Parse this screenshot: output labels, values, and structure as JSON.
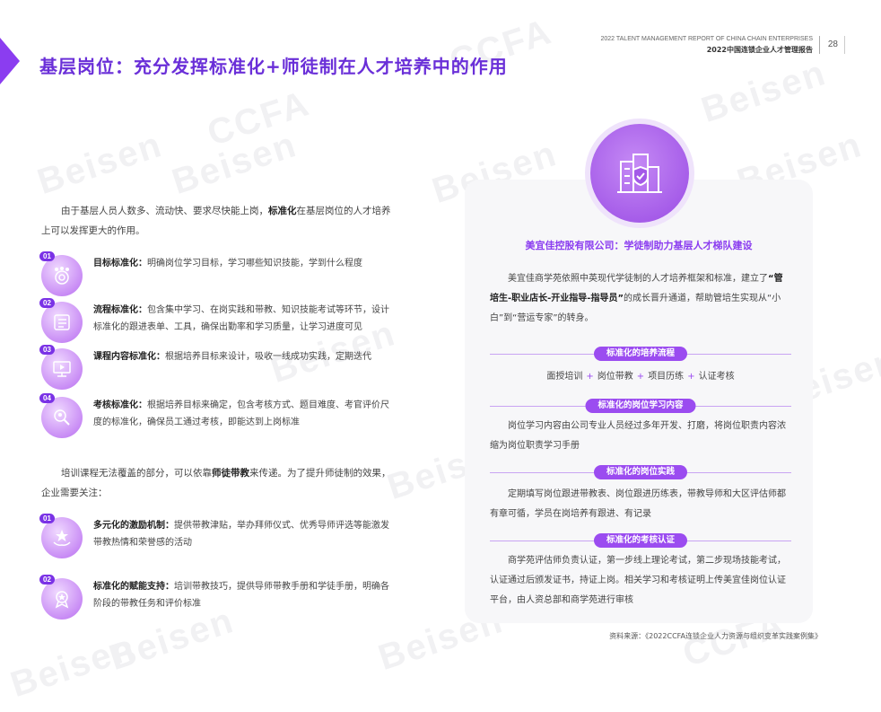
{
  "header": {
    "en": "2022 TALENT MANAGEMENT REPORT OF CHINA CHAIN ENTERPRISES",
    "cn": "2022中国连锁企业人才管理报告",
    "page": "28"
  },
  "title": "基层岗位：充分发挥标准化+师徒制在人才培养中的作用",
  "watermarks": [
    "Beisen",
    "CCFA"
  ],
  "intro": {
    "pre": "由于基层人员人数多、流动快、要求尽快能上岗，",
    "bold": "标准化",
    "post": "在基层岗位的人才培养上可以发挥更大的作用。"
  },
  "standards": [
    {
      "num": "01",
      "icon": "target-people-icon",
      "label": "目标标准化：",
      "text": "明确岗位学习目标，学习哪些知识技能，学到什么程度"
    },
    {
      "num": "02",
      "icon": "process-checklist-icon",
      "label": "流程标准化：",
      "text": "包含集中学习、在岗实践和带教、知识技能考试等环节，设计标准化的跟进表单、工具，确保出勤率和学习质量，让学习进度可见"
    },
    {
      "num": "03",
      "icon": "course-screen-icon",
      "label": "课程内容标准化：",
      "text": "根据培养目标来设计，吸收一线成功实践，定期迭代"
    },
    {
      "num": "04",
      "icon": "assessment-search-icon",
      "label": "考核标准化：",
      "text": "根据培养目标来确定，包含考核方式、题目难度、考官评价尺度的标准化，确保员工通过考核，即能达到上岗标准"
    }
  ],
  "mentor_para": {
    "pre": "培训课程无法覆盖的部分，可以依靠",
    "bold": "师徒带教",
    "post": "来传递。为了提升师徒制的效果，企业需要关注："
  },
  "mentor_items": [
    {
      "num": "01",
      "icon": "incentive-hands-icon",
      "label": "多元化的激励机制：",
      "text": "提供带教津贴，举办拜师仪式、优秀导师评选等能激发带教热情和荣誉感的活动"
    },
    {
      "num": "02",
      "icon": "empower-badge-icon",
      "label": "标准化的赋能支持：",
      "text": "培训带教技巧，提供导师带教手册和学徒手册，明确各阶段的带教任务和评价标准"
    }
  ],
  "case": {
    "icon": "office-building-shield-icon",
    "title": "美宜佳控股有限公司：学徒制助力基层人才梯队建设",
    "intro_pre": "美宜佳商学苑依照中英现代学徒制的人才培养框架和标准，建立了",
    "intro_bold": "“管培生-职业店长-开业指导-指导员”",
    "intro_post": "的成长晋升通道，帮助管培生实现从“小白”到“营运专家”的转身。",
    "sections": [
      {
        "pill": "标准化的培养流程"
      },
      {
        "pill": "标准化的岗位学习内容",
        "text": "岗位学习内容由公司专业人员经过多年开发、打磨，将岗位职责内容浓缩为岗位职责学习手册"
      },
      {
        "pill": "标准化的岗位实践",
        "text": "定期填写岗位跟进带教表、岗位跟进历练表，带教导师和大区评估师都有章可循，学员在岗培养有跟进、有记录"
      },
      {
        "pill": "标准化的考核认证",
        "text": "商学苑评估师负责认证，第一步线上理论考试，第二步现场技能考试，认证通过后颁发证书，持证上岗。相关学习和考核证明上传美宜佳岗位认证平台，由人资总部和商学苑进行审核"
      }
    ],
    "flow": [
      "面授培训",
      "岗位带教",
      "项目历练",
      "认证考核"
    ],
    "plus": "+"
  },
  "source": "资料来源：《2022CCFA连锁企业人力资源与组织变革实践案例集》",
  "colors": {
    "accent": "#8b3df0",
    "title": "#6a2fd8",
    "pill": "#9b4cf0"
  }
}
